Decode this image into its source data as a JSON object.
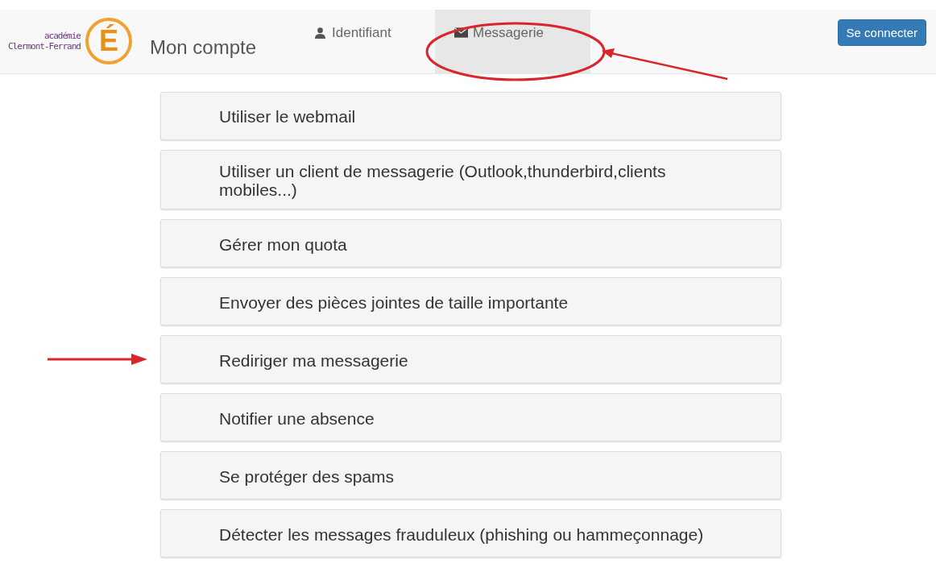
{
  "header": {
    "logo": {
      "line_1": "académie",
      "line_2": "Clermont-Ferrand",
      "letter": "É"
    },
    "title": "Mon compte",
    "tabs": [
      {
        "label": "Identifiant",
        "selected": false,
        "circled": false
      },
      {
        "label": "Messagerie",
        "selected": true,
        "circled": true
      }
    ],
    "login_button": "Se connecter"
  },
  "items": [
    {
      "label": "Utiliser le webmail",
      "pointed": false
    },
    {
      "label": "Utiliser un client de messagerie (Outlook,thunderbird,clients mobiles...)",
      "pointed": false
    },
    {
      "label": "Gérer mon quota",
      "pointed": false
    },
    {
      "label": "Envoyer des pièces jointes de taille importante",
      "pointed": false
    },
    {
      "label": "Rediriger ma messagerie",
      "pointed": true
    },
    {
      "label": "Notifier une absence",
      "pointed": false
    },
    {
      "label": "Se protéger des spams",
      "pointed": false
    },
    {
      "label": "Détecter les messages frauduleux (phishing ou hammeçonnage)",
      "pointed": false
    }
  ]
}
